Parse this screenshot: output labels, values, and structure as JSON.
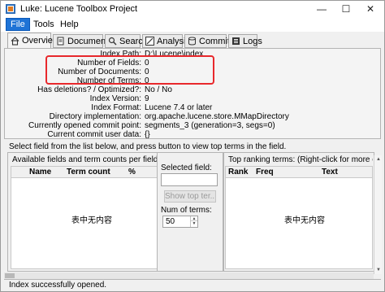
{
  "window": {
    "title": "Luke: Lucene Toolbox Project",
    "minimize": "—",
    "maximize": "☐",
    "close": "✕"
  },
  "menu": {
    "file": "File",
    "tools": "Tools",
    "help": "Help"
  },
  "tabs": [
    {
      "label": "Overview",
      "icon": "home-icon",
      "active": true
    },
    {
      "label": "Documents",
      "icon": "document-icon"
    },
    {
      "label": "Search",
      "icon": "search-icon"
    },
    {
      "label": "Analysis",
      "icon": "analysis-icon"
    },
    {
      "label": "Commits",
      "icon": "database-icon"
    },
    {
      "label": "Logs",
      "icon": "list-icon"
    }
  ],
  "overview": {
    "rows": [
      {
        "label": "Index Path:",
        "value": "D:\\Lucene\\index"
      },
      {
        "label": "Number of Fields:",
        "value": "0"
      },
      {
        "label": "Number of Documents:",
        "value": "0"
      },
      {
        "label": "Number of Terms:",
        "value": "0"
      },
      {
        "label": "Has deletions? / Optimized?:",
        "value": "No / No"
      },
      {
        "label": "Index Version:",
        "value": "9"
      },
      {
        "label": "Index Format:",
        "value": "Lucene 7.4 or later"
      },
      {
        "label": "Directory implementation:",
        "value": "org.apache.lucene.store.MMapDirectory"
      },
      {
        "label": "Currently opened commit point:",
        "value": "segments_3 (generation=3, segs=0)"
      },
      {
        "label": "Current commit user data:",
        "value": "{}"
      }
    ],
    "highlight_color": "#e8282c"
  },
  "instructions": "Select field from the list below, and press button to view top terms in the field.",
  "fields_panel": {
    "title": "Available fields and term counts per field:",
    "columns": [
      "Name",
      "Term count",
      "%"
    ],
    "empty_message": "表中无内容"
  },
  "middle_panel": {
    "selected_field_label": "Selected field:",
    "selected_field_value": "",
    "show_top_button": "Show top ter...",
    "num_terms_label": "Num of terms:",
    "num_terms_value": "50"
  },
  "terms_panel": {
    "title": "Top ranking terms: (Right-click for more opti...",
    "columns": [
      "Rank",
      "Freq",
      "Text"
    ],
    "empty_message": "表中无内容"
  },
  "status": "Index successfully opened.",
  "colors": {
    "menu_active": "#1e73d6",
    "highlight": "#e8282c"
  }
}
